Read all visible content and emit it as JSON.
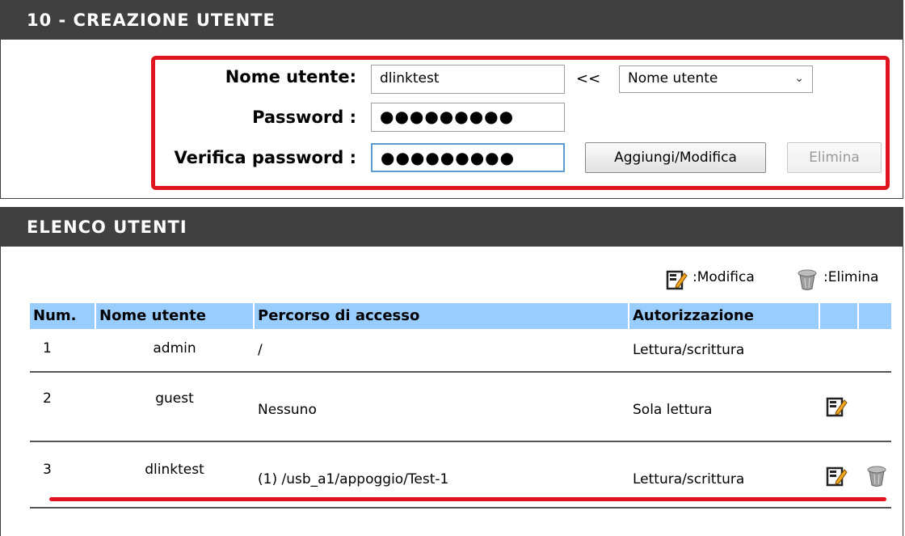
{
  "create_user": {
    "title": "10 - CREAZIONE UTENTE",
    "username_label": "Nome utente:",
    "username_value": "dlinktest",
    "arrow_label": "<<",
    "user_select_value": "Nome utente",
    "password_label": "Password :",
    "password_value": "●●●●●●●●●",
    "verify_label": "Verifica password :",
    "verify_value": "●●●●●●●●●",
    "add_modify_button": "Aggiungi/Modifica",
    "delete_button": "Elimina"
  },
  "user_list": {
    "title": "ELENCO UTENTI",
    "legend_edit": ":Modifica",
    "legend_delete": ":Elimina",
    "columns": [
      "Num.",
      "Nome utente",
      "Percorso di accesso",
      "Autorizzazione"
    ],
    "rows": [
      {
        "num": "1",
        "user": "admin",
        "path": "/",
        "auth": "Lettura/scrittura",
        "edit": false,
        "delete": false
      },
      {
        "num": "2",
        "user": "guest",
        "path": "Nessuno",
        "auth": "Sola lettura",
        "edit": true,
        "delete": false
      },
      {
        "num": "3",
        "user": "dlinktest",
        "path": "(1) /usb_a1/appoggio/Test-1",
        "auth": "Lettura/scrittura",
        "edit": true,
        "delete": true
      }
    ]
  },
  "colors": {
    "header_bg": "#404040",
    "table_header_bg": "#99ccff",
    "highlight_red": "#e0141e"
  },
  "icons": {
    "edit": "edit-icon",
    "delete": "trash-icon"
  }
}
